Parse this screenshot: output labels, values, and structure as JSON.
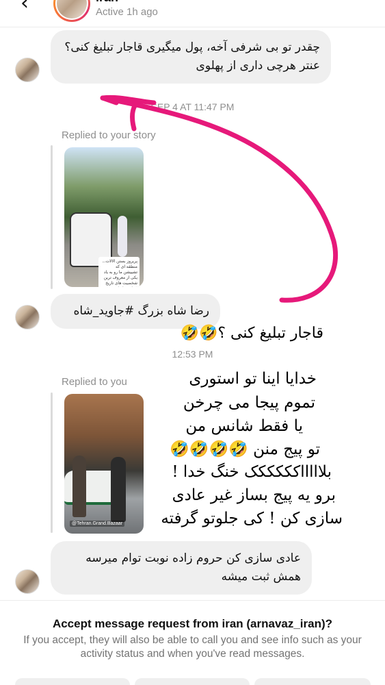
{
  "header": {
    "name": "iran",
    "status": "Active 1h ago"
  },
  "messages": {
    "m1": "چقدر تو بی شرفی آخه، پول میگیری قاجار تبلیغ کنی؟ عنتر هرچی داری از پهلوی",
    "ts1": "SEP 4 AT 11:47 PM",
    "replied1": "Replied to your story",
    "m2": "رضا شاه بزرگ #جاوید_شاه",
    "ts2": "12:53 PM",
    "replied2": "Replied to you",
    "m3": "عادی سازی کن حروم زاده نوبت توام میرسه همش ثبت میشه"
  },
  "story1_caption": "پریروز بستن الالات... منطقه ای که تشییشن ما رو به یاد یکی از معروف ترین شخصیت های تاریخ سیاسی ایران می اندازه استخرش پر رو نگاه",
  "story2_tag": "@Tehran.Grand.Bazaar",
  "annotation": {
    "line1": "قاجار تبلیغ کنی ؟🤣🤣",
    "line2": "خدایا اینا تو استوری",
    "line3": "تموم پیجا می چرخن",
    "line4": "یا فقط شانس من",
    "line5": "تو پیج منن 🤣🤣🤣🤣",
    "line6": "بلاااااکککککک خنگ خدا !",
    "line7": "برو یه پیج بساز غیر عادی",
    "line8": "سازی کن ! کی جلوتو گرفته",
    "arrow_color": "#e6197a"
  },
  "footer": {
    "title": "Accept message request from iran (arnavaz_iran)?",
    "body": "If you accept, they will also be able to call you and see info such as your activity status and when you've read messages."
  }
}
